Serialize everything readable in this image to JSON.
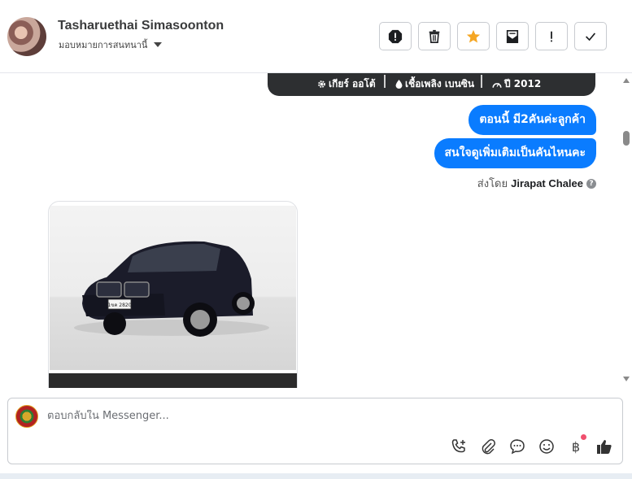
{
  "header": {
    "contact_name": "Tasharuethai Simasoonton",
    "assign_label": "มอบหมายการสนทนานี้",
    "actions": [
      {
        "name": "spam-button",
        "icon": "alert-octagon-icon"
      },
      {
        "name": "delete-button",
        "icon": "trash-icon"
      },
      {
        "name": "star-button",
        "icon": "star-icon"
      },
      {
        "name": "mark-unread-button",
        "icon": "envelope-icon"
      },
      {
        "name": "follow-up-button",
        "icon": "exclamation-icon"
      },
      {
        "name": "done-button",
        "icon": "check-icon"
      }
    ],
    "star_color": "#f5a623"
  },
  "chat": {
    "car_specs": {
      "gear": "เกียร์ ออโต้",
      "fuel": "เชื้อเพลิง เบนซิน",
      "year": "ปี 2012"
    },
    "messages": [
      {
        "text": "ตอนนี้ มี2คันค่ะลูกค้า"
      },
      {
        "text": "สนใจดูเพิ่มเติมเป็นคันไหนคะ"
      }
    ],
    "sent_by_prefix": "ส่งโดย",
    "sent_by_name": "Jirapat Chalee",
    "help_glyph": "?",
    "license_plate": "1ขค 2820",
    "bubble_color": "#0a7cff"
  },
  "composer": {
    "placeholder": "ตอบกลับใน Messenger...",
    "baht_symbol": "฿",
    "tools": [
      "call-add-icon",
      "paperclip-icon",
      "saved-reply-icon",
      "emoji-icon",
      "baht-icon",
      "thumbs-up-icon"
    ]
  }
}
